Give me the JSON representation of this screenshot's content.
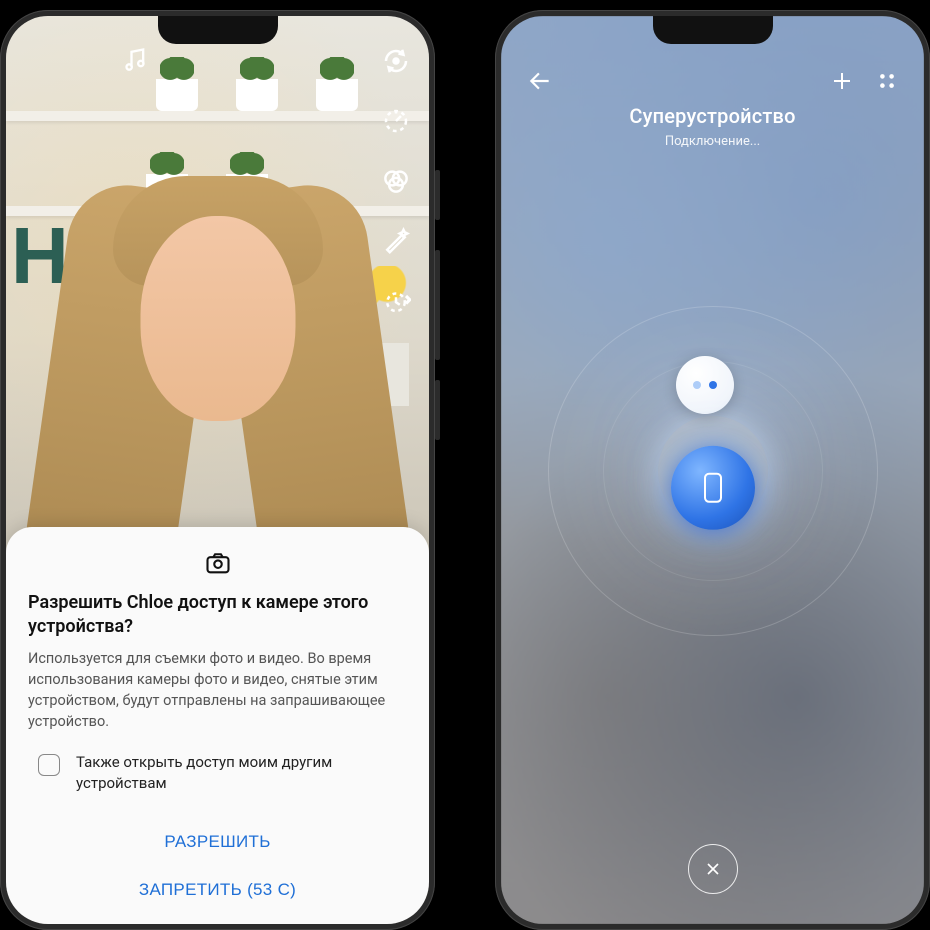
{
  "left": {
    "rail": {
      "music": "music-note-icon",
      "refresh": "refresh-icon",
      "timer": "speed-icon",
      "filter": "color-filter-icon",
      "magic": "magic-wand-icon",
      "history": "timer-icon"
    },
    "dialog": {
      "title": "Разрешить Chloe доступ к камере этого устройства?",
      "body": "Используется для съемки фото и видео. Во время использования камеры фото и видео, снятые этим устройством, будут отправлены на запрашивающее устройство.",
      "checkbox_label": "Также открыть доступ моим другим устройствам",
      "allow": "РАЗРЕШИТЬ",
      "deny": "ЗАПРЕТИТЬ (53 С)"
    }
  },
  "right": {
    "title": "Суперустройство",
    "subtitle": "Подключение...",
    "devices": {
      "primary": "phone-icon",
      "secondary": "earbuds-icon"
    },
    "close": "close-icon"
  }
}
